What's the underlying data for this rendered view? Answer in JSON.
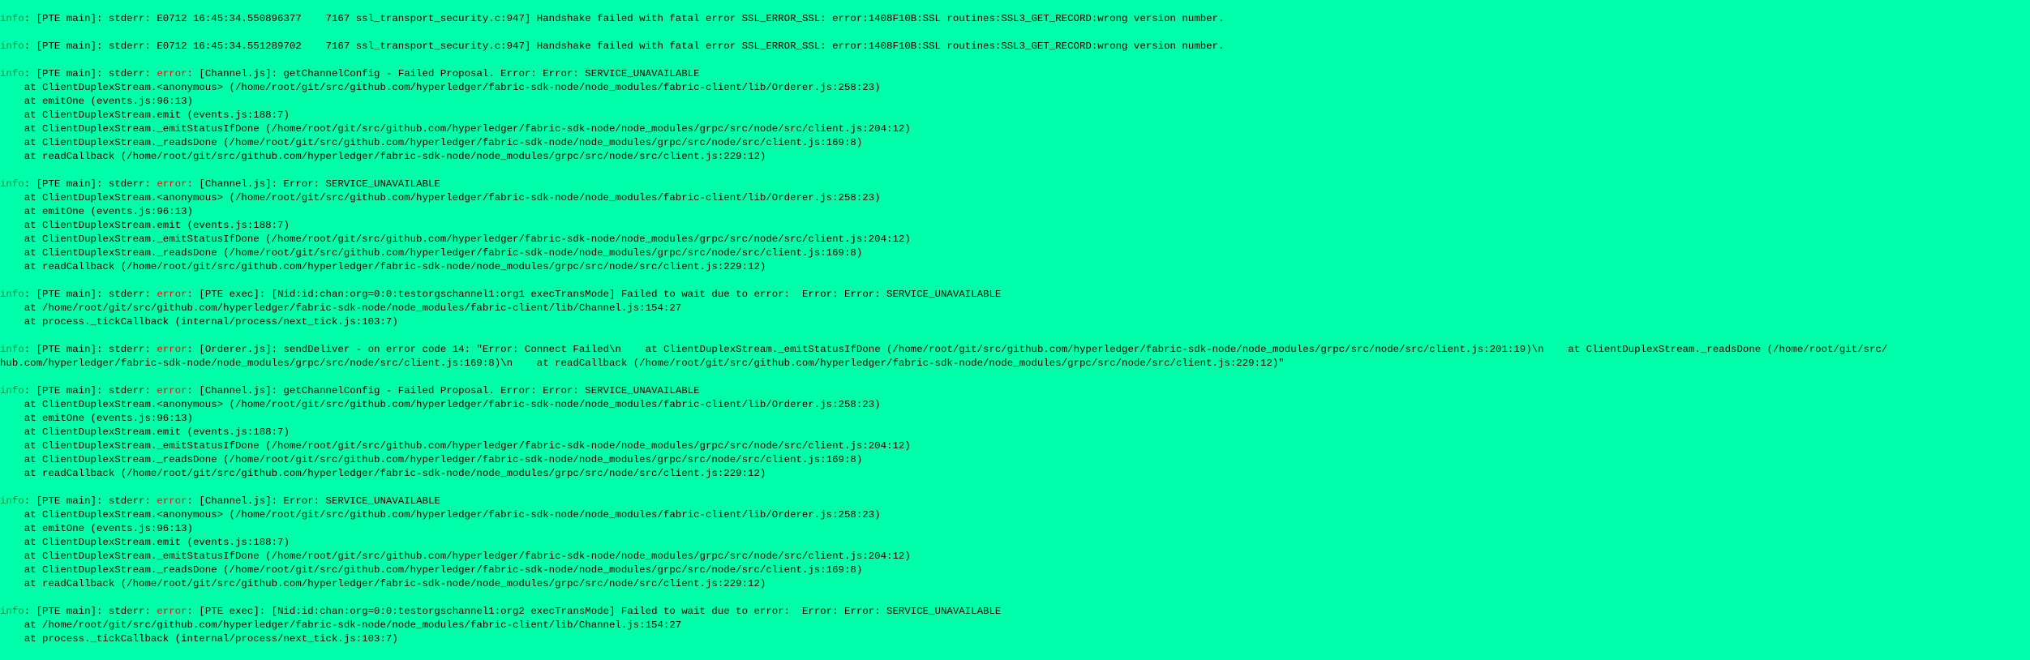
{
  "terminal": {
    "entries": [
      {
        "level": "info",
        "head": ": [PTE main]: stderr: E0712 16:45:34.550896377    7167 ssl_transport_security.c:947] Handshake failed with fatal error SSL_ERROR_SSL: error:1408F10B:SSL routines:SSL3_GET_RECORD:wrong version number.",
        "continuation": []
      },
      {
        "level": "info",
        "head": ": [PTE main]: stderr: E0712 16:45:34.551289702    7167 ssl_transport_security.c:947] Handshake failed with fatal error SSL_ERROR_SSL: error:1408F10B:SSL routines:SSL3_GET_RECORD:wrong version number.",
        "continuation": []
      },
      {
        "level": "info",
        "prefix": ": [PTE main]: stderr: ",
        "error_word": "error",
        "rest": ": [Channel.js]: getChannelConfig - Failed Proposal. Error: Error: SERVICE_UNAVAILABLE",
        "continuation": [
          "    at ClientDuplexStream.<anonymous> (/home/root/git/src/github.com/hyperledger/fabric-sdk-node/node_modules/fabric-client/lib/Orderer.js:258:23)",
          "    at emitOne (events.js:96:13)",
          "    at ClientDuplexStream.emit (events.js:188:7)",
          "    at ClientDuplexStream._emitStatusIfDone (/home/root/git/src/github.com/hyperledger/fabric-sdk-node/node_modules/grpc/src/node/src/client.js:204:12)",
          "    at ClientDuplexStream._readsDone (/home/root/git/src/github.com/hyperledger/fabric-sdk-node/node_modules/grpc/src/node/src/client.js:169:8)",
          "    at readCallback (/home/root/git/src/github.com/hyperledger/fabric-sdk-node/node_modules/grpc/src/node/src/client.js:229:12)"
        ]
      },
      {
        "level": "info",
        "prefix": ": [PTE main]: stderr: ",
        "error_word": "error",
        "rest": ": [Channel.js]: Error: SERVICE_UNAVAILABLE",
        "continuation": [
          "    at ClientDuplexStream.<anonymous> (/home/root/git/src/github.com/hyperledger/fabric-sdk-node/node_modules/fabric-client/lib/Orderer.js:258:23)",
          "    at emitOne (events.js:96:13)",
          "    at ClientDuplexStream.emit (events.js:188:7)",
          "    at ClientDuplexStream._emitStatusIfDone (/home/root/git/src/github.com/hyperledger/fabric-sdk-node/node_modules/grpc/src/node/src/client.js:204:12)",
          "    at ClientDuplexStream._readsDone (/home/root/git/src/github.com/hyperledger/fabric-sdk-node/node_modules/grpc/src/node/src/client.js:169:8)",
          "    at readCallback (/home/root/git/src/github.com/hyperledger/fabric-sdk-node/node_modules/grpc/src/node/src/client.js:229:12)"
        ]
      },
      {
        "level": "info",
        "prefix": ": [PTE main]: stderr: ",
        "error_word": "error",
        "rest": ": [PTE exec]: [Nid:id:chan:org=0:0:testorgschannel1:org1 execTransMode] Failed to wait due to error:  Error: Error: SERVICE_UNAVAILABLE",
        "continuation": [
          "    at /home/root/git/src/github.com/hyperledger/fabric-sdk-node/node_modules/fabric-client/lib/Channel.js:154:27",
          "    at process._tickCallback (internal/process/next_tick.js:103:7)"
        ]
      },
      {
        "level": "info",
        "prefix": ": [PTE main]: stderr: ",
        "error_word": "error",
        "rest": ": [Orderer.js]: sendDeliver - on error code 14: \"Error: Connect Failed\\n    at ClientDuplexStream._emitStatusIfDone (/home/root/git/src/github.com/hyperledger/fabric-sdk-node/node_modules/grpc/src/node/src/client.js:201:19)\\n    at ClientDuplexStream._readsDone (/home/root/git/src/",
        "continuation": [
          "hub.com/hyperledger/fabric-sdk-node/node_modules/grpc/src/node/src/client.js:169:8)\\n    at readCallback (/home/root/git/src/github.com/hyperledger/fabric-sdk-node/node_modules/grpc/src/node/src/client.js:229:12)\""
        ]
      },
      {
        "level": "info",
        "prefix": ": [PTE main]: stderr: ",
        "error_word": "error",
        "rest": ": [Channel.js]: getChannelConfig - Failed Proposal. Error: Error: SERVICE_UNAVAILABLE",
        "continuation": [
          "    at ClientDuplexStream.<anonymous> (/home/root/git/src/github.com/hyperledger/fabric-sdk-node/node_modules/fabric-client/lib/Orderer.js:258:23)",
          "    at emitOne (events.js:96:13)",
          "    at ClientDuplexStream.emit (events.js:188:7)",
          "    at ClientDuplexStream._emitStatusIfDone (/home/root/git/src/github.com/hyperledger/fabric-sdk-node/node_modules/grpc/src/node/src/client.js:204:12)",
          "    at ClientDuplexStream._readsDone (/home/root/git/src/github.com/hyperledger/fabric-sdk-node/node_modules/grpc/src/node/src/client.js:169:8)",
          "    at readCallback (/home/root/git/src/github.com/hyperledger/fabric-sdk-node/node_modules/grpc/src/node/src/client.js:229:12)"
        ]
      },
      {
        "level": "info",
        "prefix": ": [PTE main]: stderr: ",
        "error_word": "error",
        "rest": ": [Channel.js]: Error: SERVICE_UNAVAILABLE",
        "continuation": [
          "    at ClientDuplexStream.<anonymous> (/home/root/git/src/github.com/hyperledger/fabric-sdk-node/node_modules/fabric-client/lib/Orderer.js:258:23)",
          "    at emitOne (events.js:96:13)",
          "    at ClientDuplexStream.emit (events.js:188:7)",
          "    at ClientDuplexStream._emitStatusIfDone (/home/root/git/src/github.com/hyperledger/fabric-sdk-node/node_modules/grpc/src/node/src/client.js:204:12)",
          "    at ClientDuplexStream._readsDone (/home/root/git/src/github.com/hyperledger/fabric-sdk-node/node_modules/grpc/src/node/src/client.js:169:8)",
          "    at readCallback (/home/root/git/src/github.com/hyperledger/fabric-sdk-node/node_modules/grpc/src/node/src/client.js:229:12)"
        ]
      },
      {
        "level": "info",
        "prefix": ": [PTE main]: stderr: ",
        "error_word": "error",
        "rest": ": [PTE exec]: [Nid:id:chan:org=0:0:testorgschannel1:org2 execTransMode] Failed to wait due to error:  Error: Error: SERVICE_UNAVAILABLE",
        "continuation": [
          "    at /home/root/git/src/github.com/hyperledger/fabric-sdk-node/node_modules/fabric-client/lib/Channel.js:154:27",
          "    at process._tickCallback (internal/process/next_tick.js:103:7)"
        ]
      }
    ]
  },
  "colors": {
    "background": "#00ffaa",
    "text": "#000000",
    "info_label": "#008a3a",
    "error_label": "#ff0000"
  }
}
